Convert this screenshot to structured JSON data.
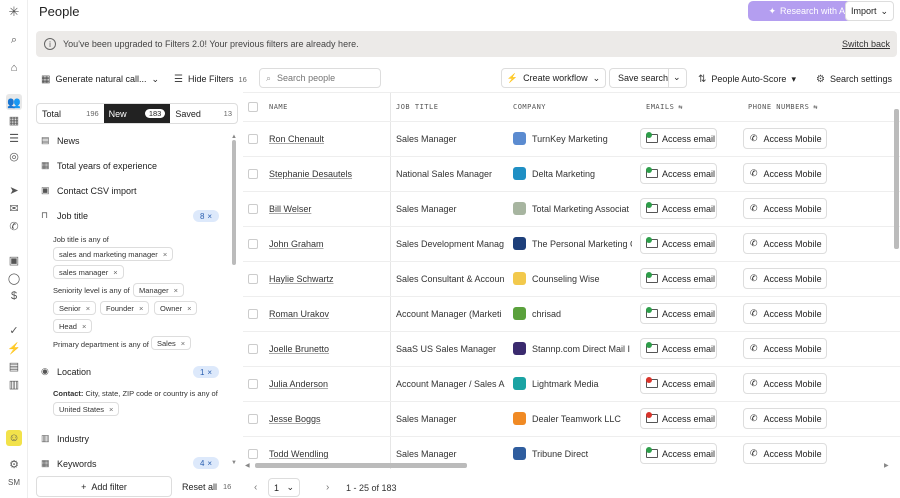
{
  "app": {
    "title": "People"
  },
  "rail": {
    "user_initials": "SM"
  },
  "header": {
    "research_label": "Research with AI",
    "import_label": "Import"
  },
  "banner": {
    "message": "You've been upgraded to Filters 2.0! Your previous filters are already here.",
    "switch_back": "Switch back"
  },
  "toolbar": {
    "generate": "Generate natural call...",
    "hide_filters": "Hide Filters",
    "hide_filters_count": "16",
    "search_placeholder": "Search people",
    "create_workflow": "Create workflow",
    "save_search": "Save search",
    "auto_score": "People Auto-Score",
    "search_settings": "Search settings"
  },
  "tabs": [
    {
      "label": "Total",
      "count": "196"
    },
    {
      "label": "New",
      "count": "183"
    },
    {
      "label": "Saved",
      "count": "13"
    }
  ],
  "filters": {
    "news": "News",
    "years": "Total years of experience",
    "csv": "Contact CSV import",
    "job_title": "Job title",
    "job_title_count": "8",
    "job_title_is_any": "Job title is any of",
    "job_chips": [
      "sales and marketing manager",
      "sales manager"
    ],
    "seniority_is_any": "Seniority level is any of",
    "seniority_chips": [
      "Manager",
      "Senior",
      "Founder",
      "Owner",
      "Head"
    ],
    "dept_is_any": "Primary department is any of",
    "dept_chip": "Sales",
    "location": "Location",
    "location_count": "1",
    "contact_prefix": "Contact:",
    "contact_text": "City, state, ZIP code or country is any of",
    "location_chip": "United States",
    "industry": "Industry",
    "keywords": "Keywords",
    "keywords_count": "4",
    "add_filter": "Add filter",
    "reset_all": "Reset all",
    "reset_count": "16"
  },
  "columns": {
    "name": "NAME",
    "job_title": "JOB TITLE",
    "company": "COMPANY",
    "emails": "EMAILS",
    "phone": "PHONE NUMBERS"
  },
  "actions": {
    "email": "Access email",
    "mobile": "Access Mobile"
  },
  "rows": [
    {
      "name": "Ron Chenault",
      "title": "Sales Manager",
      "company": "TurnKey Marketing",
      "logo_color": "#5b8bd0",
      "email_status": "green"
    },
    {
      "name": "Stephanie Desautels",
      "title": "National Sales Manager",
      "company": "Delta Marketing",
      "logo_color": "#1f8fc4",
      "email_status": "green"
    },
    {
      "name": "Bill Welser",
      "title": "Sales Manager",
      "company": "Total Marketing Associat",
      "logo_color": "#a7b5a0",
      "email_status": "green"
    },
    {
      "name": "John Graham",
      "title": "Sales Development Manag",
      "company": "The Personal Marketing C",
      "logo_color": "#1d3f7a",
      "email_status": "green"
    },
    {
      "name": "Haylie Schwartz",
      "title": "Sales Consultant & Accoun",
      "company": "Counseling Wise",
      "logo_color": "#f2c94c",
      "email_status": "green"
    },
    {
      "name": "Roman Urakov",
      "title": "Account Manager (Marketi",
      "company": "chrisad",
      "logo_color": "#5aa13c",
      "email_status": "green"
    },
    {
      "name": "Joelle Brunetto",
      "title": "SaaS US Sales Manager",
      "company": "Stannp.com Direct Mail I",
      "logo_color": "#3a2a6e",
      "email_status": "green"
    },
    {
      "name": "Julia Anderson",
      "title": "Account Manager / Sales A",
      "company": "Lightmark Media",
      "logo_color": "#1aa3a3",
      "email_status": "red"
    },
    {
      "name": "Jesse Boggs",
      "title": "Sales Manager",
      "company": "Dealer Teamwork LLC",
      "logo_color": "#f08a24",
      "email_status": "red"
    },
    {
      "name": "Todd Wendling",
      "title": "Sales Manager",
      "company": "Tribune Direct",
      "logo_color": "#2f5d9e",
      "email_status": "green"
    }
  ],
  "pager": {
    "page": "1",
    "range": "1 - 25 of 183"
  }
}
